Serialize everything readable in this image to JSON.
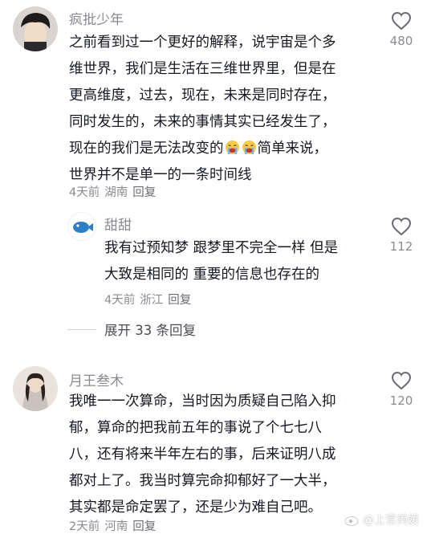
{
  "comments": [
    {
      "username": "疯批少年",
      "lines": [
        "之前看到过一个更好的解释，说宇宙是个多",
        "维世界，我们是生活在三维世界里，但是在",
        "更高维度，过去，现在，未来是同时存在，",
        "同时发生的，未来的事情其实已经发生了，",
        "现在的我们是无法改变的",
        "简单来说，",
        "世界并不是单一的一条时间线"
      ],
      "time": "4天前",
      "location": "湖南",
      "reply_label": "回复",
      "likes": "480"
    },
    {
      "username": "甜甜",
      "lines": [
        "我有过预知梦 跟梦里不完全一样 但是",
        "大致是相同的 重要的信息也存在的"
      ],
      "time": "4天前",
      "location": "浙江",
      "reply_label": "回复",
      "likes": "112"
    },
    {
      "username": "月王叁木",
      "lines": [
        "我唯一一次算命，当时因为质疑自己陷入抑",
        "郁，算命的把我前五年的事说了个七七八",
        "八，还有将来半年左右的事，后来证明八成",
        "都对上了。我当时算完命抑郁好了一大半，",
        "其实都是命定罢了，还是少为难自己吧。"
      ],
      "time": "2天前",
      "location": "河南",
      "reply_label": "回复",
      "likes": "120"
    }
  ],
  "expand_replies": "展开 33 条回复",
  "watermark": "@上官美媛",
  "icons": {
    "like": "heart-outline-icon",
    "emoji": "crying-face-emoji-icon",
    "watermark": "weibo-logo-icon"
  },
  "colors": {
    "text": "#161823",
    "muted": "#8a8b91",
    "background": "#ffffff"
  }
}
